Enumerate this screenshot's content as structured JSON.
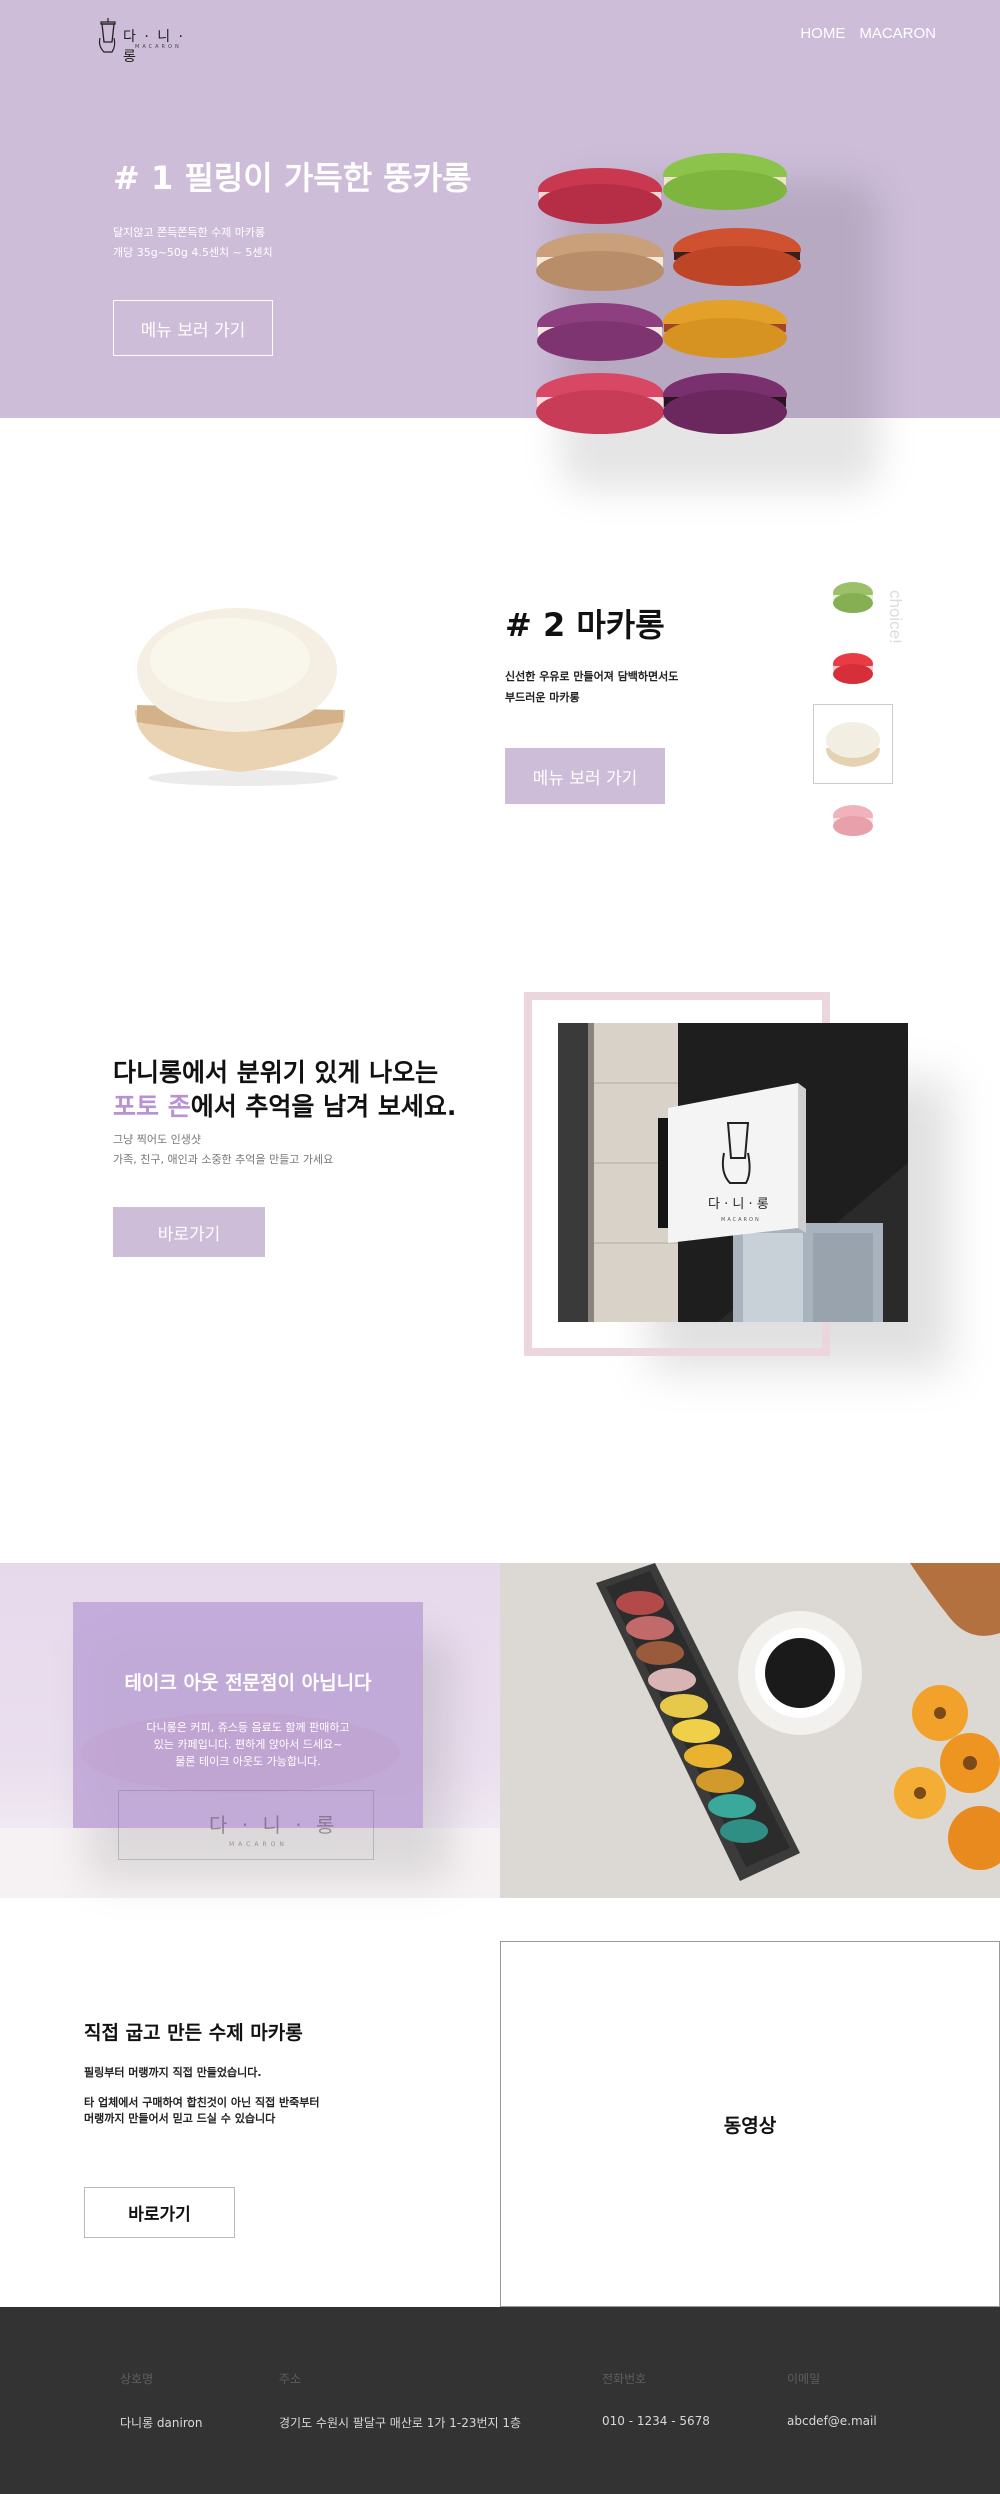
{
  "header": {
    "logo_text": "다 · 니 · 롱",
    "logo_sub": "MACARON",
    "nav": [
      "HOME",
      "MACARON"
    ]
  },
  "hero": {
    "title": "# 1 필링이 가득한 뚱카롱",
    "line1": "달지않고 쫀득쫀득한 수제 마카롱",
    "line2": "개당 35g~50g 4.5센치 ~ 5센치",
    "button": "메뉴 보러 가기"
  },
  "section2": {
    "title": "# 2 마카롱",
    "line1": "신선한 우유로 만들어져 담백하면서도",
    "line2": "부드러운 마카롱",
    "button": "메뉴 보러 가기",
    "side_label": "choice!",
    "thumbnails": [
      "green-macaron",
      "red-macaron",
      "white-macaron",
      "pink-macaron"
    ],
    "selected_thumbnail": 2
  },
  "section3": {
    "heading1": "다니롱에서 분위기 있게 나오는",
    "heading2_accent": "포토 존",
    "heading2_rest": "에서 추억을 남겨 보세요.",
    "line1": "그냥 찍어도 인생샷",
    "line2": "가족, 친구, 애인과 소중한 추억을 만들고 가세요",
    "button": "바로가기",
    "sign_text": "다 · 니 · 롱",
    "sign_sub": "MACARON"
  },
  "section4": {
    "title": "테이크 아웃 전문점이 아닙니다",
    "line1": "다니롱은 커피, 쥬스등 음료도 함께 판매하고",
    "line2": "있는 카페입니다. 편하게 앉아서 드세요~",
    "line3": "물론 테이크 아웃도 가능합니다.",
    "watermark": "다 · 니 · 롱",
    "watermark_sub": "MACARON"
  },
  "section5": {
    "title": "직접 굽고 만든 수제 마카롱",
    "line1": "필링부터 머랭까지 직접 만들었습니다.",
    "line2": "타 업체에서 구매하여 합친것이 아닌 직접 반죽부터",
    "line3": "머랭까지 만들어서 믿고 드실 수 있습니다",
    "button": "바로가기",
    "video_label": "동영상"
  },
  "footer": {
    "columns": [
      {
        "label": "상호명",
        "value": "다니롱 daniron"
      },
      {
        "label": "주소",
        "value": "경기도 수원시 팔달구 매산로 1가 1-23번지 1층"
      },
      {
        "label": "전화번호",
        "value": "010 - 1234 - 5678"
      },
      {
        "label": "이메일",
        "value": "abcdef@e.mail"
      }
    ]
  },
  "colors": {
    "lavender": "#cdbdd9",
    "accent_purple": "#b893d4",
    "footer_bg": "#333333",
    "frame_pink": "#ead6dc"
  }
}
